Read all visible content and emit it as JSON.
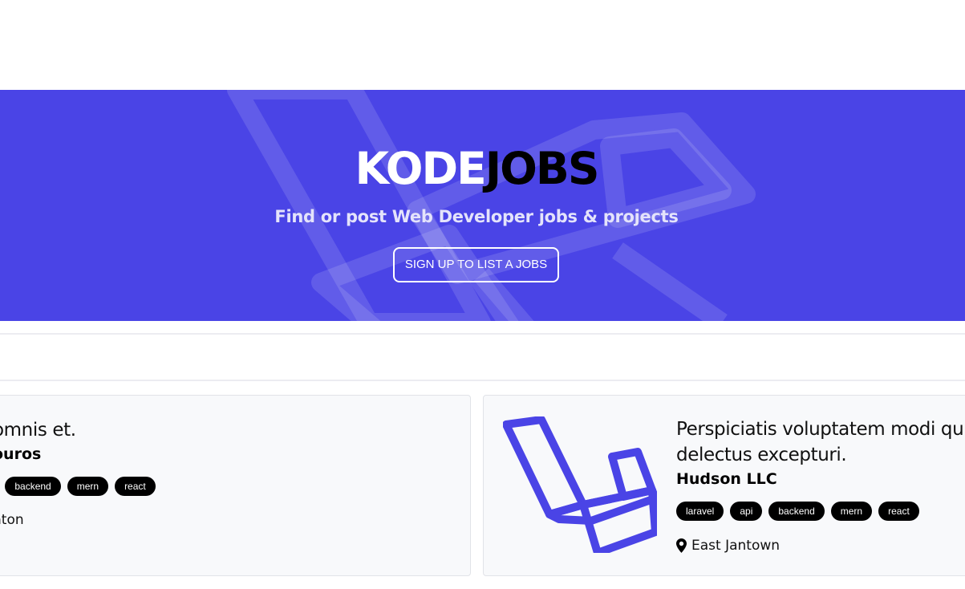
{
  "hero": {
    "title_part1": "KODE",
    "title_part2": "JOBS",
    "subtitle": "Find or post Web Developer jobs & projects",
    "cta_label": "SIGN UP TO LIST A JOBS",
    "background_color": "#4a44e6"
  },
  "listings": [
    {
      "title": "omnis et.",
      "company": "ouros",
      "tags": [
        "backend",
        "mern",
        "react"
      ],
      "location": "nton",
      "logo_icon": "laravel-logo-icon"
    },
    {
      "title_line1": "Perspiciatis voluptatem modi quid",
      "title_line2": "delectus excepturi.",
      "company": "Hudson LLC",
      "tags": [
        "laravel",
        "api",
        "backend",
        "mern",
        "react"
      ],
      "location": "East Jantown",
      "logo_icon": "laravel-logo-icon"
    }
  ],
  "colors": {
    "accent": "#4a44e6",
    "tag_bg": "#000000",
    "card_bg": "#f8f9fb"
  }
}
